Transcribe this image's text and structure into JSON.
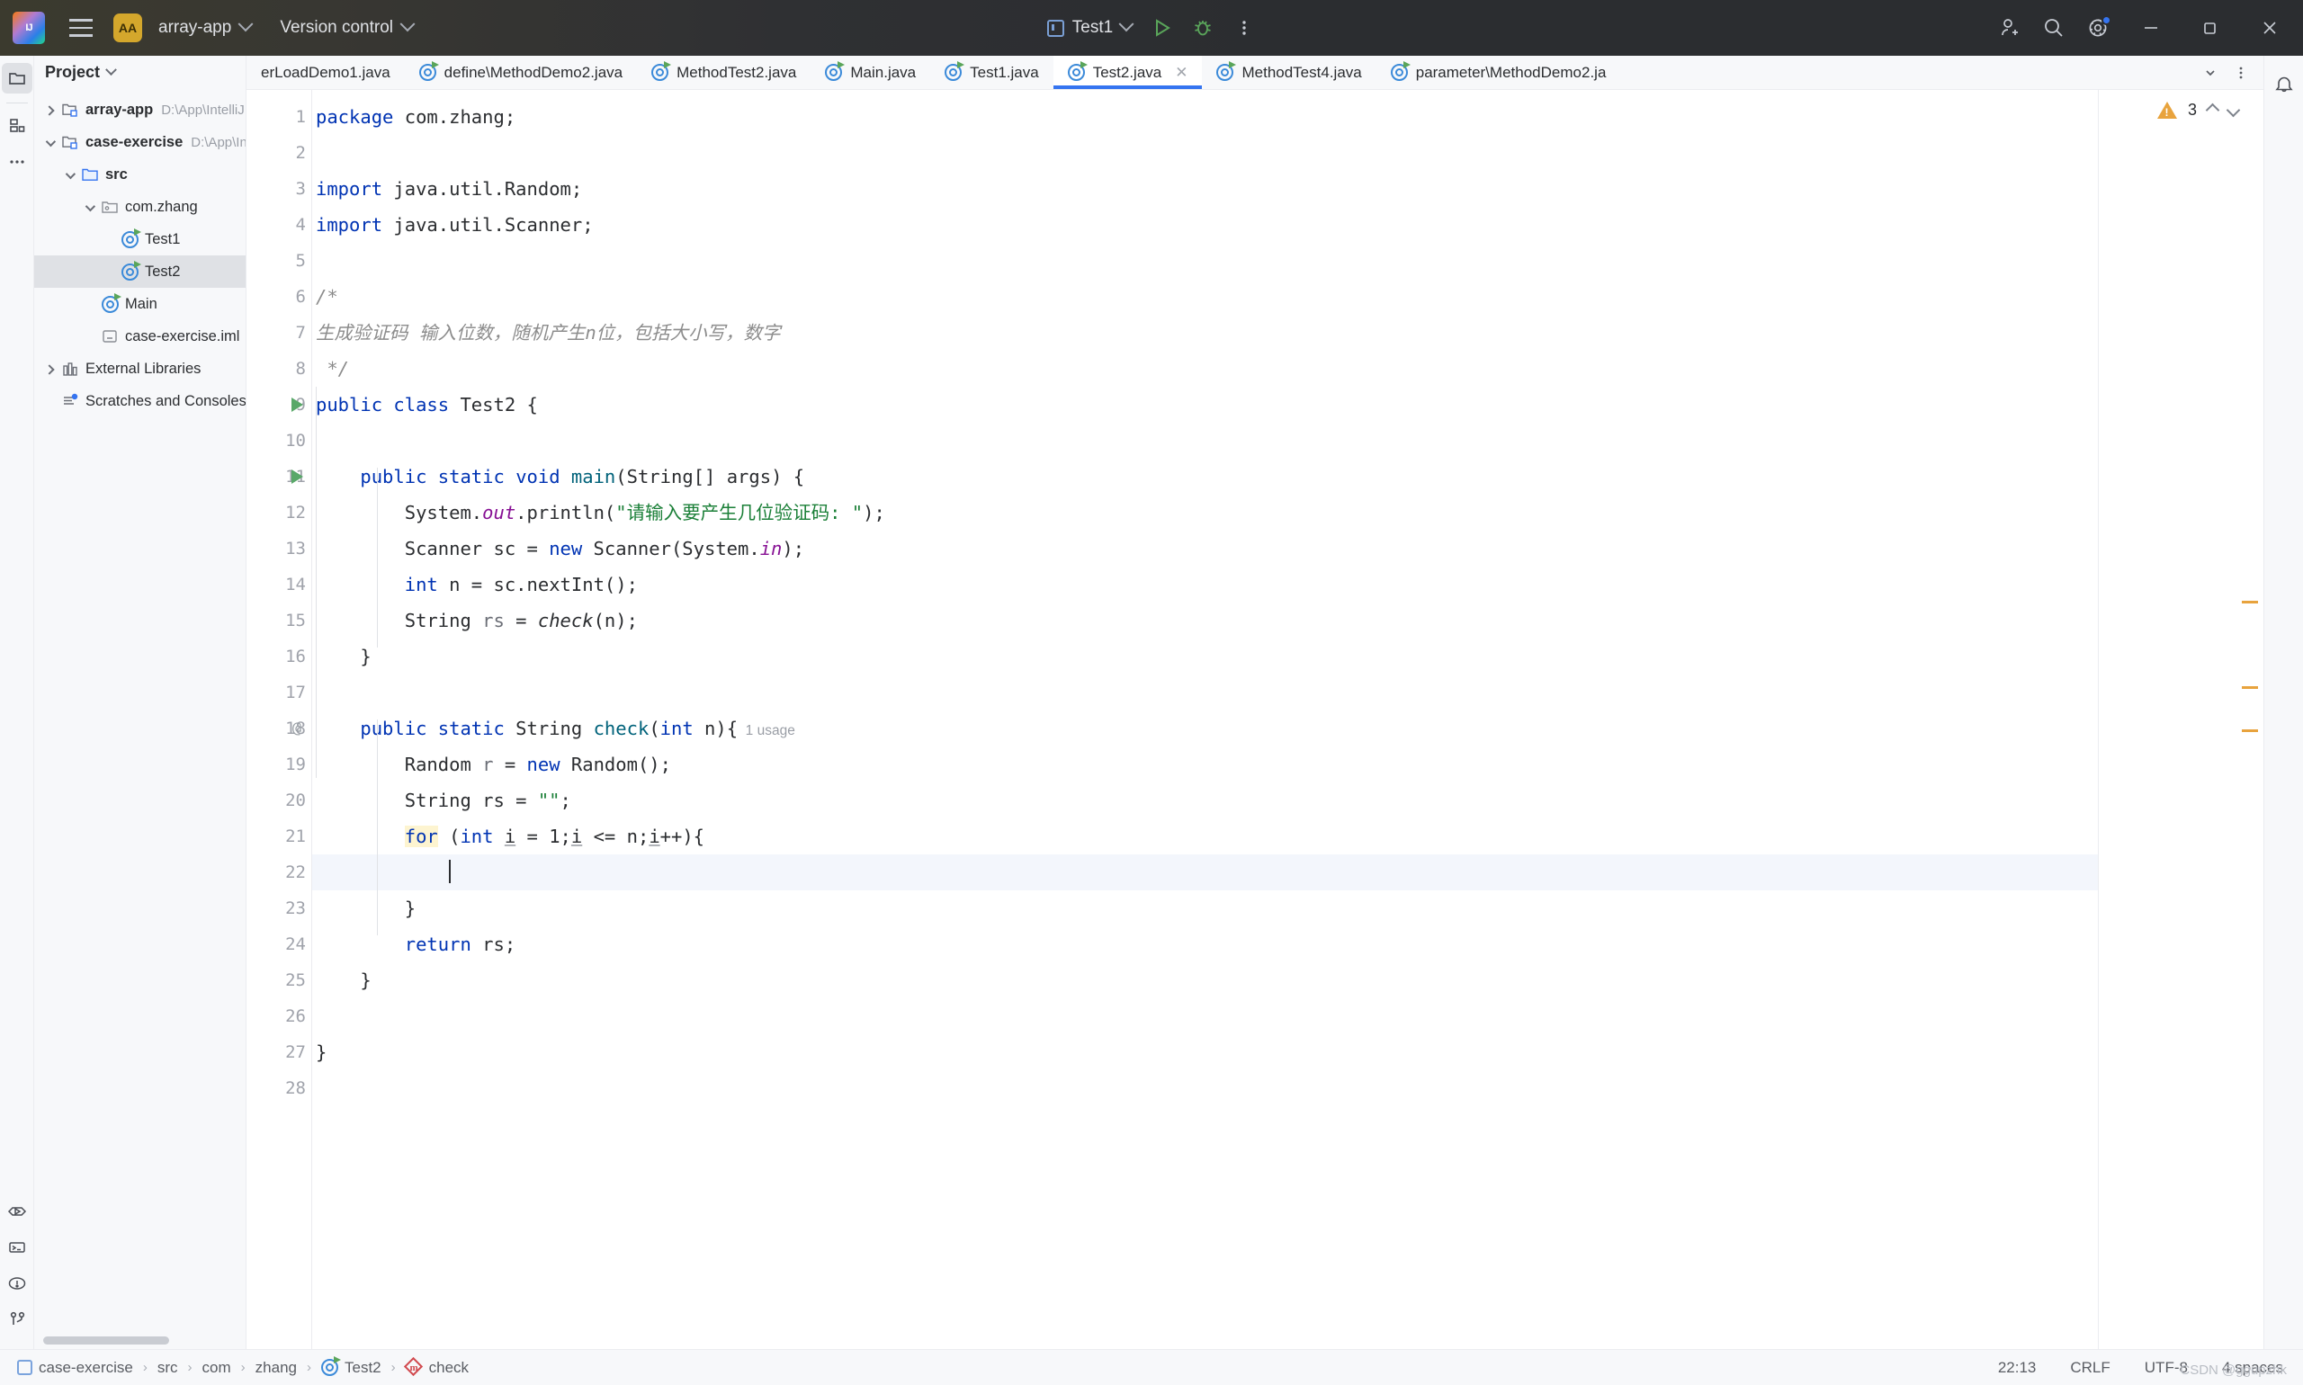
{
  "titlebar": {
    "logo_alt": "intellij-idea-logo",
    "menu_icon": "hamburger-menu-icon",
    "project_badge": "AA",
    "project_name": "array-app",
    "version_control": "Version control",
    "run_config": "Test1",
    "icons": {
      "run": "run-icon",
      "debug": "debug-icon",
      "more": "more-options-icon",
      "add_user": "add-user-icon",
      "search": "search-icon",
      "settings": "settings-icon",
      "minimize": "minimize-icon",
      "maximize": "maximize-icon",
      "close": "close-icon"
    }
  },
  "rail": {
    "items": [
      {
        "name": "project-tool-window",
        "icon": "folder-icon",
        "active": true
      },
      {
        "name": "structure-tool-window",
        "icon": "structure-icon",
        "active": false
      },
      {
        "name": "more-tool-windows",
        "icon": "ellipsis-icon",
        "active": false
      }
    ],
    "bottom_items": [
      {
        "name": "run-tool-window",
        "icon": "run-panel-icon"
      },
      {
        "name": "terminal-tool-window",
        "icon": "terminal-icon"
      },
      {
        "name": "problems-tool-window",
        "icon": "problems-icon"
      },
      {
        "name": "version-control-tool-window",
        "icon": "branch-icon"
      }
    ]
  },
  "project_panel": {
    "title": "Project",
    "tree": [
      {
        "label": "array-app",
        "path": "D:\\App\\IntelliJ IDEA C",
        "indent": 0,
        "arrow": "right",
        "icon": "module-folder-icon",
        "bold": true,
        "selected": false
      },
      {
        "label": "case-exercise",
        "path": "D:\\App\\IntelliJ IDE",
        "indent": 0,
        "arrow": "down",
        "icon": "module-folder-icon",
        "bold": true,
        "selected": false
      },
      {
        "label": "src",
        "path": "",
        "indent": 1,
        "arrow": "down",
        "icon": "source-folder-icon",
        "bold": true,
        "selected": false
      },
      {
        "label": "com.zhang",
        "path": "",
        "indent": 2,
        "arrow": "down",
        "icon": "package-icon",
        "bold": false,
        "selected": false
      },
      {
        "label": "Test1",
        "path": "",
        "indent": 3,
        "arrow": "none",
        "icon": "java-class-icon",
        "bold": false,
        "selected": false
      },
      {
        "label": "Test2",
        "path": "",
        "indent": 3,
        "arrow": "none",
        "icon": "java-class-icon",
        "bold": false,
        "selected": true
      },
      {
        "label": "Main",
        "path": "",
        "indent": 2,
        "arrow": "none",
        "icon": "java-class-icon",
        "bold": false,
        "selected": false
      },
      {
        "label": "case-exercise.iml",
        "path": "",
        "indent": 2,
        "arrow": "none",
        "icon": "iml-file-icon",
        "bold": false,
        "selected": false
      },
      {
        "label": "External Libraries",
        "path": "",
        "indent": 0,
        "arrow": "right",
        "icon": "library-icon",
        "bold": false,
        "selected": false
      },
      {
        "label": "Scratches and Consoles",
        "path": "",
        "indent": 0,
        "arrow": "none",
        "icon": "scratches-icon",
        "bold": false,
        "selected": false
      }
    ]
  },
  "tabs": [
    {
      "label": "erLoadDemo1.java",
      "icon": false,
      "active": false,
      "closable": false,
      "clipped": true
    },
    {
      "label": "define\\MethodDemo2.java",
      "icon": true,
      "active": false,
      "closable": false,
      "clipped": false
    },
    {
      "label": "MethodTest2.java",
      "icon": true,
      "active": false,
      "closable": false,
      "clipped": false
    },
    {
      "label": "Main.java",
      "icon": true,
      "active": false,
      "closable": false,
      "clipped": false
    },
    {
      "label": "Test1.java",
      "icon": true,
      "active": false,
      "closable": false,
      "clipped": false
    },
    {
      "label": "Test2.java",
      "icon": true,
      "active": true,
      "closable": true,
      "clipped": false
    },
    {
      "label": "MethodTest4.java",
      "icon": true,
      "active": false,
      "closable": false,
      "clipped": false
    },
    {
      "label": "parameter\\MethodDemo2.ja",
      "icon": true,
      "active": false,
      "closable": false,
      "clipped": true
    }
  ],
  "tab_actions": {
    "chevron": "chevron-down-icon",
    "more": "more-tabs-icon"
  },
  "editor": {
    "warning_count": "3",
    "warning_icon": "warning-triangle-icon",
    "prev_icon": "previous-problem-icon",
    "next_icon": "next-problem-icon",
    "cursor_line": 22,
    "usage_hint": "1 usage",
    "lines": [
      {
        "n": 1,
        "text": "package com.zhang;"
      },
      {
        "n": 2,
        "text": ""
      },
      {
        "n": 3,
        "text": "import java.util.Random;"
      },
      {
        "n": 4,
        "text": "import java.util.Scanner;"
      },
      {
        "n": 5,
        "text": ""
      },
      {
        "n": 6,
        "text": "/*"
      },
      {
        "n": 7,
        "text": "生成验证码 输入位数，随机产生n位，包括大小写，数字"
      },
      {
        "n": 8,
        "text": " */"
      },
      {
        "n": 9,
        "text": "public class Test2 {"
      },
      {
        "n": 10,
        "text": ""
      },
      {
        "n": 11,
        "text": "    public static void main(String[] args) {"
      },
      {
        "n": 12,
        "text": "        System.out.println(\"请输入要产生几位验证码: \");"
      },
      {
        "n": 13,
        "text": "        Scanner sc = new Scanner(System.in);"
      },
      {
        "n": 14,
        "text": "        int n = sc.nextInt();"
      },
      {
        "n": 15,
        "text": "        String rs = check(n);"
      },
      {
        "n": 16,
        "text": "    }"
      },
      {
        "n": 17,
        "text": ""
      },
      {
        "n": 18,
        "text": "    public static String check(int n){  1 usage"
      },
      {
        "n": 19,
        "text": "        Random r = new Random();"
      },
      {
        "n": 20,
        "text": "        String rs = \"\";"
      },
      {
        "n": 21,
        "text": "        for (int i = 1;i <= n;i++){"
      },
      {
        "n": 22,
        "text": "            "
      },
      {
        "n": 23,
        "text": "        }"
      },
      {
        "n": 24,
        "text": "        return rs;"
      },
      {
        "n": 25,
        "text": "    }"
      },
      {
        "n": 26,
        "text": ""
      },
      {
        "n": 27,
        "text": "}"
      },
      {
        "n": 28,
        "text": ""
      }
    ]
  },
  "statusbar": {
    "breadcrumbs": [
      {
        "label": "case-exercise",
        "icon": "module-icon"
      },
      {
        "label": "src",
        "icon": "none"
      },
      {
        "label": "com",
        "icon": "none"
      },
      {
        "label": "zhang",
        "icon": "none"
      },
      {
        "label": "Test2",
        "icon": "java-class-icon"
      },
      {
        "label": "check",
        "icon": "method-icon"
      }
    ],
    "position": "22:13",
    "line_separator": "CRLF",
    "encoding": "UTF-8",
    "indent": "4 spaces",
    "watermark": "CSDN @ggupzhk"
  },
  "colors": {
    "accent": "#3574f0",
    "keyword": "#0033b3",
    "string": "#1a7f37",
    "comment": "#8c8c8c",
    "field": "#871094",
    "method": "#00627a",
    "warning": "#e8a33d",
    "selection": "#dfe1e5"
  }
}
